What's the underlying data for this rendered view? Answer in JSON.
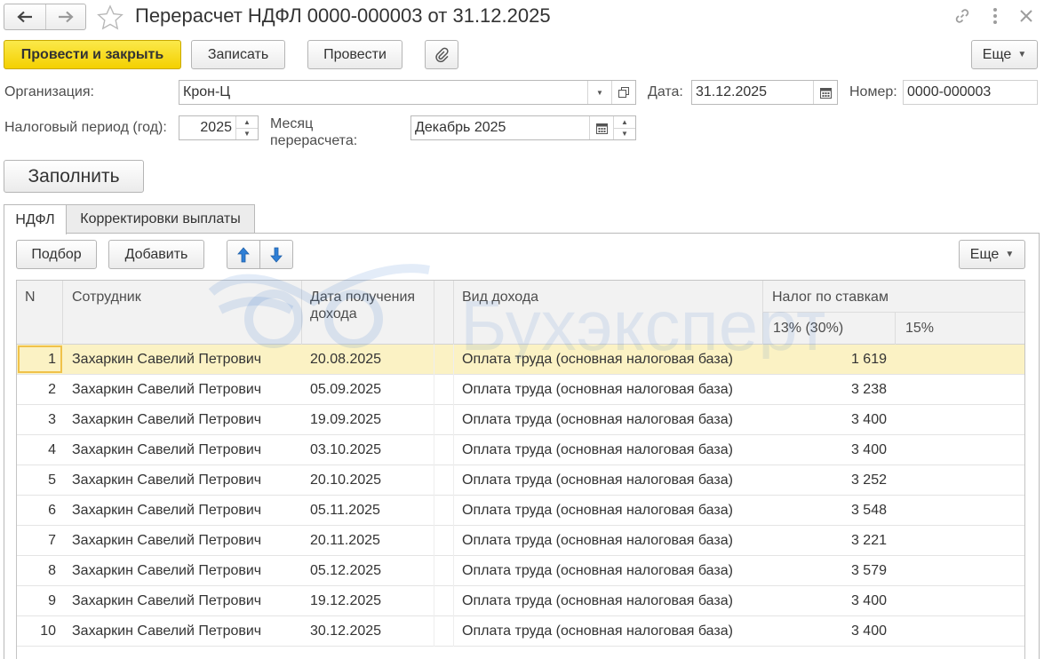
{
  "window": {
    "title": "Перерасчет НДФЛ 0000-000003 от 31.12.2025"
  },
  "toolbar": {
    "post_close": "Провести и закрыть",
    "save": "Записать",
    "post": "Провести",
    "more": "Еще"
  },
  "form": {
    "org_label": "Организация:",
    "org_value": "Крон-Ц",
    "date_label": "Дата:",
    "date_value": "31.12.2025",
    "number_label": "Номер:",
    "number_value": "0000-000003",
    "period_label": "Налоговый период (год):",
    "period_value": "2025",
    "month_label_1": "Месяц",
    "month_label_2": "перерасчета:",
    "month_value": "Декабрь 2025",
    "fill_button": "Заполнить"
  },
  "tabs": [
    {
      "label": "НДФЛ"
    },
    {
      "label": "Корректировки выплаты"
    }
  ],
  "table_toolbar": {
    "pick": "Подбор",
    "add": "Добавить",
    "more": "Еще"
  },
  "table": {
    "headers": {
      "n": "N",
      "employee": "Сотрудник",
      "date_1": "Дата получения",
      "date_2": "дохода",
      "income_type": "Вид дохода",
      "tax_group": "Налог по ставкам",
      "rate_13": "13% (30%)",
      "rate_15": "15%"
    },
    "rows": [
      {
        "n": "1",
        "employee": "Захаркин Савелий Петрович",
        "date": "20.08.2025",
        "income": "Оплата труда (основная налоговая база)",
        "tax13": "1 619",
        "tax15": ""
      },
      {
        "n": "2",
        "employee": "Захаркин Савелий Петрович",
        "date": "05.09.2025",
        "income": "Оплата труда (основная налоговая база)",
        "tax13": "3 238",
        "tax15": ""
      },
      {
        "n": "3",
        "employee": "Захаркин Савелий Петрович",
        "date": "19.09.2025",
        "income": "Оплата труда (основная налоговая база)",
        "tax13": "3 400",
        "tax15": ""
      },
      {
        "n": "4",
        "employee": "Захаркин Савелий Петрович",
        "date": "03.10.2025",
        "income": "Оплата труда (основная налоговая база)",
        "tax13": "3 400",
        "tax15": ""
      },
      {
        "n": "5",
        "employee": "Захаркин Савелий Петрович",
        "date": "20.10.2025",
        "income": "Оплата труда (основная налоговая база)",
        "tax13": "3 252",
        "tax15": ""
      },
      {
        "n": "6",
        "employee": "Захаркин Савелий Петрович",
        "date": "05.11.2025",
        "income": "Оплата труда (основная налоговая база)",
        "tax13": "3 548",
        "tax15": ""
      },
      {
        "n": "7",
        "employee": "Захаркин Савелий Петрович",
        "date": "20.11.2025",
        "income": "Оплата труда (основная налоговая база)",
        "tax13": "3 221",
        "tax15": ""
      },
      {
        "n": "8",
        "employee": "Захаркин Савелий Петрович",
        "date": "05.12.2025",
        "income": "Оплата труда (основная налоговая база)",
        "tax13": "3 579",
        "tax15": ""
      },
      {
        "n": "9",
        "employee": "Захаркин Савелий Петрович",
        "date": "19.12.2025",
        "income": "Оплата труда (основная налоговая база)",
        "tax13": "3 400",
        "tax15": ""
      },
      {
        "n": "10",
        "employee": "Захаркин Савелий Петрович",
        "date": "30.12.2025",
        "income": "Оплата труда (основная налоговая база)",
        "tax13": "3 400",
        "tax15": ""
      }
    ]
  },
  "watermark": {
    "text": "Бухэксперт"
  },
  "icons": {
    "back": "arrow-left-icon",
    "forward": "arrow-right-icon",
    "favorite": "star-icon",
    "link": "link-icon",
    "menu": "more-vertical-icon",
    "close": "close-icon",
    "attach": "paperclip-icon",
    "dropdown": "chevron-down-icon",
    "open": "open-form-icon",
    "calendar": "calendar-icon",
    "move_up": "arrow-up-icon",
    "move_down": "arrow-down-icon"
  },
  "colors": {
    "primary_button": "#f4d000",
    "selected_row": "#fbf2c4",
    "arrow_blue": "#2f7fd6"
  }
}
